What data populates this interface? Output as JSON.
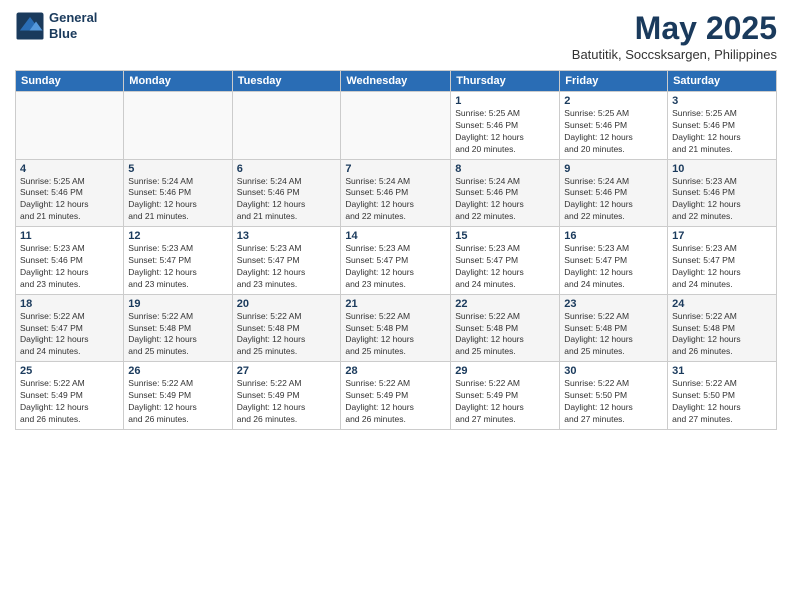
{
  "logo": {
    "line1": "General",
    "line2": "Blue"
  },
  "title": "May 2025",
  "subtitle": "Batutitik, Soccsksargen, Philippines",
  "headers": [
    "Sunday",
    "Monday",
    "Tuesday",
    "Wednesday",
    "Thursday",
    "Friday",
    "Saturday"
  ],
  "weeks": [
    [
      {
        "day": "",
        "info": ""
      },
      {
        "day": "",
        "info": ""
      },
      {
        "day": "",
        "info": ""
      },
      {
        "day": "",
        "info": ""
      },
      {
        "day": "1",
        "info": "Sunrise: 5:25 AM\nSunset: 5:46 PM\nDaylight: 12 hours\nand 20 minutes."
      },
      {
        "day": "2",
        "info": "Sunrise: 5:25 AM\nSunset: 5:46 PM\nDaylight: 12 hours\nand 20 minutes."
      },
      {
        "day": "3",
        "info": "Sunrise: 5:25 AM\nSunset: 5:46 PM\nDaylight: 12 hours\nand 21 minutes."
      }
    ],
    [
      {
        "day": "4",
        "info": "Sunrise: 5:25 AM\nSunset: 5:46 PM\nDaylight: 12 hours\nand 21 minutes."
      },
      {
        "day": "5",
        "info": "Sunrise: 5:24 AM\nSunset: 5:46 PM\nDaylight: 12 hours\nand 21 minutes."
      },
      {
        "day": "6",
        "info": "Sunrise: 5:24 AM\nSunset: 5:46 PM\nDaylight: 12 hours\nand 21 minutes."
      },
      {
        "day": "7",
        "info": "Sunrise: 5:24 AM\nSunset: 5:46 PM\nDaylight: 12 hours\nand 22 minutes."
      },
      {
        "day": "8",
        "info": "Sunrise: 5:24 AM\nSunset: 5:46 PM\nDaylight: 12 hours\nand 22 minutes."
      },
      {
        "day": "9",
        "info": "Sunrise: 5:24 AM\nSunset: 5:46 PM\nDaylight: 12 hours\nand 22 minutes."
      },
      {
        "day": "10",
        "info": "Sunrise: 5:23 AM\nSunset: 5:46 PM\nDaylight: 12 hours\nand 22 minutes."
      }
    ],
    [
      {
        "day": "11",
        "info": "Sunrise: 5:23 AM\nSunset: 5:46 PM\nDaylight: 12 hours\nand 23 minutes."
      },
      {
        "day": "12",
        "info": "Sunrise: 5:23 AM\nSunset: 5:47 PM\nDaylight: 12 hours\nand 23 minutes."
      },
      {
        "day": "13",
        "info": "Sunrise: 5:23 AM\nSunset: 5:47 PM\nDaylight: 12 hours\nand 23 minutes."
      },
      {
        "day": "14",
        "info": "Sunrise: 5:23 AM\nSunset: 5:47 PM\nDaylight: 12 hours\nand 23 minutes."
      },
      {
        "day": "15",
        "info": "Sunrise: 5:23 AM\nSunset: 5:47 PM\nDaylight: 12 hours\nand 24 minutes."
      },
      {
        "day": "16",
        "info": "Sunrise: 5:23 AM\nSunset: 5:47 PM\nDaylight: 12 hours\nand 24 minutes."
      },
      {
        "day": "17",
        "info": "Sunrise: 5:23 AM\nSunset: 5:47 PM\nDaylight: 12 hours\nand 24 minutes."
      }
    ],
    [
      {
        "day": "18",
        "info": "Sunrise: 5:22 AM\nSunset: 5:47 PM\nDaylight: 12 hours\nand 24 minutes."
      },
      {
        "day": "19",
        "info": "Sunrise: 5:22 AM\nSunset: 5:48 PM\nDaylight: 12 hours\nand 25 minutes."
      },
      {
        "day": "20",
        "info": "Sunrise: 5:22 AM\nSunset: 5:48 PM\nDaylight: 12 hours\nand 25 minutes."
      },
      {
        "day": "21",
        "info": "Sunrise: 5:22 AM\nSunset: 5:48 PM\nDaylight: 12 hours\nand 25 minutes."
      },
      {
        "day": "22",
        "info": "Sunrise: 5:22 AM\nSunset: 5:48 PM\nDaylight: 12 hours\nand 25 minutes."
      },
      {
        "day": "23",
        "info": "Sunrise: 5:22 AM\nSunset: 5:48 PM\nDaylight: 12 hours\nand 25 minutes."
      },
      {
        "day": "24",
        "info": "Sunrise: 5:22 AM\nSunset: 5:48 PM\nDaylight: 12 hours\nand 26 minutes."
      }
    ],
    [
      {
        "day": "25",
        "info": "Sunrise: 5:22 AM\nSunset: 5:49 PM\nDaylight: 12 hours\nand 26 minutes."
      },
      {
        "day": "26",
        "info": "Sunrise: 5:22 AM\nSunset: 5:49 PM\nDaylight: 12 hours\nand 26 minutes."
      },
      {
        "day": "27",
        "info": "Sunrise: 5:22 AM\nSunset: 5:49 PM\nDaylight: 12 hours\nand 26 minutes."
      },
      {
        "day": "28",
        "info": "Sunrise: 5:22 AM\nSunset: 5:49 PM\nDaylight: 12 hours\nand 26 minutes."
      },
      {
        "day": "29",
        "info": "Sunrise: 5:22 AM\nSunset: 5:49 PM\nDaylight: 12 hours\nand 27 minutes."
      },
      {
        "day": "30",
        "info": "Sunrise: 5:22 AM\nSunset: 5:50 PM\nDaylight: 12 hours\nand 27 minutes."
      },
      {
        "day": "31",
        "info": "Sunrise: 5:22 AM\nSunset: 5:50 PM\nDaylight: 12 hours\nand 27 minutes."
      }
    ]
  ]
}
